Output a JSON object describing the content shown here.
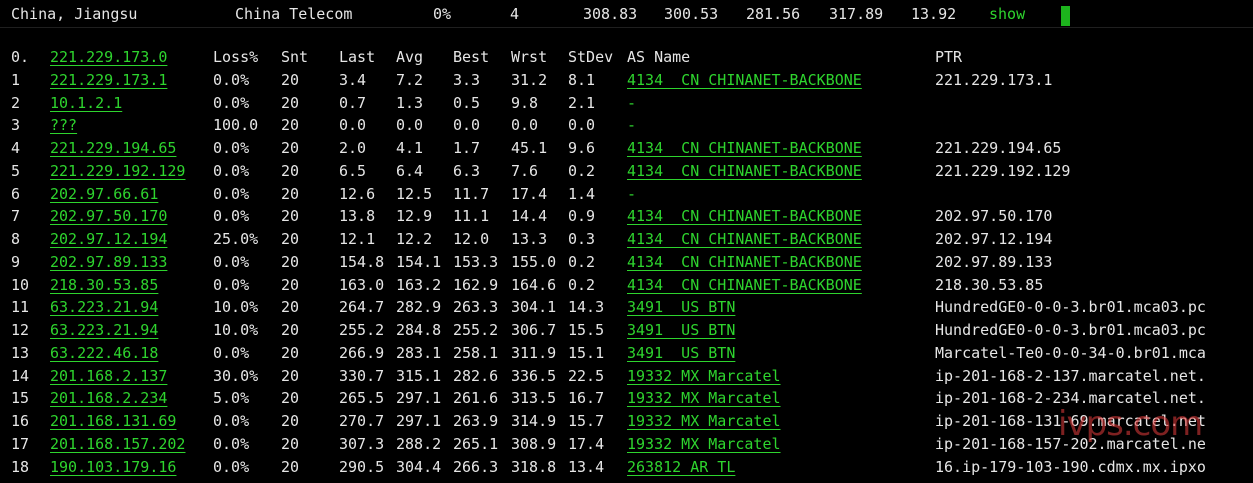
{
  "summary": {
    "location": "China, Jiangsu",
    "isp": "China Telecom",
    "loss": "0%",
    "sent": "4",
    "last": "308.83",
    "avg": "300.53",
    "best": "281.56",
    "worst": "317.89",
    "stdev": "13.92",
    "action": "show"
  },
  "table": {
    "headers": {
      "idx": "0.",
      "host": "221.229.173.0",
      "loss": "Loss%",
      "snt": "Snt",
      "last": "Last",
      "avg": "Avg",
      "best": "Best",
      "wrst": "Wrst",
      "stdev": "StDev",
      "as": "AS Name",
      "ptr": "PTR"
    },
    "rows": [
      {
        "idx": "1",
        "host": "221.229.173.1",
        "loss": "0.0%",
        "snt": "20",
        "last": "3.4",
        "avg": "7.2",
        "best": "3.3",
        "wrst": "31.2",
        "stdev": "8.1",
        "as": "4134  CN CHINANET-BACKBONE",
        "ptr": "221.229.173.1"
      },
      {
        "idx": "2",
        "host": "10.1.2.1",
        "loss": "0.0%",
        "snt": "20",
        "last": "0.7",
        "avg": "1.3",
        "best": "0.5",
        "wrst": "9.8",
        "stdev": "2.1",
        "as": "-",
        "ptr": ""
      },
      {
        "idx": "3",
        "host": "???",
        "loss": "100.0",
        "snt": "20",
        "last": "0.0",
        "avg": "0.0",
        "best": "0.0",
        "wrst": "0.0",
        "stdev": "0.0",
        "as": "-",
        "ptr": ""
      },
      {
        "idx": "4",
        "host": "221.229.194.65",
        "loss": "0.0%",
        "snt": "20",
        "last": "2.0",
        "avg": "4.1",
        "best": "1.7",
        "wrst": "45.1",
        "stdev": "9.6",
        "as": "4134  CN CHINANET-BACKBONE",
        "ptr": "221.229.194.65"
      },
      {
        "idx": "5",
        "host": "221.229.192.129",
        "loss": "0.0%",
        "snt": "20",
        "last": "6.5",
        "avg": "6.4",
        "best": "6.3",
        "wrst": "7.6",
        "stdev": "0.2",
        "as": "4134  CN CHINANET-BACKBONE",
        "ptr": "221.229.192.129"
      },
      {
        "idx": "6",
        "host": "202.97.66.61",
        "loss": "0.0%",
        "snt": "20",
        "last": "12.6",
        "avg": "12.5",
        "best": "11.7",
        "wrst": "17.4",
        "stdev": "1.4",
        "as": "-",
        "ptr": ""
      },
      {
        "idx": "7",
        "host": "202.97.50.170",
        "loss": "0.0%",
        "snt": "20",
        "last": "13.8",
        "avg": "12.9",
        "best": "11.1",
        "wrst": "14.4",
        "stdev": "0.9",
        "as": "4134  CN CHINANET-BACKBONE",
        "ptr": "202.97.50.170"
      },
      {
        "idx": "8",
        "host": "202.97.12.194",
        "loss": "25.0%",
        "snt": "20",
        "last": "12.1",
        "avg": "12.2",
        "best": "12.0",
        "wrst": "13.3",
        "stdev": "0.3",
        "as": "4134  CN CHINANET-BACKBONE",
        "ptr": "202.97.12.194"
      },
      {
        "idx": "9",
        "host": "202.97.89.133",
        "loss": "0.0%",
        "snt": "20",
        "last": "154.8",
        "avg": "154.1",
        "best": "153.3",
        "wrst": "155.0",
        "stdev": "0.2",
        "as": "4134  CN CHINANET-BACKBONE",
        "ptr": "202.97.89.133"
      },
      {
        "idx": "10",
        "host": "218.30.53.85",
        "loss": "0.0%",
        "snt": "20",
        "last": "163.0",
        "avg": "163.2",
        "best": "162.9",
        "wrst": "164.6",
        "stdev": "0.2",
        "as": "4134  CN CHINANET-BACKBONE",
        "ptr": "218.30.53.85"
      },
      {
        "idx": "11",
        "host": "63.223.21.94",
        "loss": "10.0%",
        "snt": "20",
        "last": "264.7",
        "avg": "282.9",
        "best": "263.3",
        "wrst": "304.1",
        "stdev": "14.3",
        "as": "3491  US BTN",
        "ptr": "HundredGE0-0-0-3.br01.mca03.pc"
      },
      {
        "idx": "12",
        "host": "63.223.21.94",
        "loss": "10.0%",
        "snt": "20",
        "last": "255.2",
        "avg": "284.8",
        "best": "255.2",
        "wrst": "306.7",
        "stdev": "15.5",
        "as": "3491  US BTN",
        "ptr": "HundredGE0-0-0-3.br01.mca03.pc"
      },
      {
        "idx": "13",
        "host": "63.222.46.18",
        "loss": "0.0%",
        "snt": "20",
        "last": "266.9",
        "avg": "283.1",
        "best": "258.1",
        "wrst": "311.9",
        "stdev": "15.1",
        "as": "3491  US BTN",
        "ptr": "Marcatel-Te0-0-0-34-0.br01.mca"
      },
      {
        "idx": "14",
        "host": "201.168.2.137",
        "loss": "30.0%",
        "snt": "20",
        "last": "330.7",
        "avg": "315.1",
        "best": "282.6",
        "wrst": "336.5",
        "stdev": "22.5",
        "as": "19332 MX Marcatel",
        "ptr": "ip-201-168-2-137.marcatel.net."
      },
      {
        "idx": "15",
        "host": "201.168.2.234",
        "loss": "5.0%",
        "snt": "20",
        "last": "265.5",
        "avg": "297.1",
        "best": "261.6",
        "wrst": "313.5",
        "stdev": "16.7",
        "as": "19332 MX Marcatel",
        "ptr": "ip-201-168-2-234.marcatel.net."
      },
      {
        "idx": "16",
        "host": "201.168.131.69",
        "loss": "0.0%",
        "snt": "20",
        "last": "270.7",
        "avg": "297.1",
        "best": "263.9",
        "wrst": "314.9",
        "stdev": "15.7",
        "as": "19332 MX Marcatel",
        "ptr": "ip-201-168-131-69.marcatel.net"
      },
      {
        "idx": "17",
        "host": "201.168.157.202",
        "loss": "0.0%",
        "snt": "20",
        "last": "307.3",
        "avg": "288.2",
        "best": "265.1",
        "wrst": "308.9",
        "stdev": "17.4",
        "as": "19332 MX Marcatel",
        "ptr": "ip-201-168-157-202.marcatel.ne"
      },
      {
        "idx": "18",
        "host": "190.103.179.16",
        "loss": "0.0%",
        "snt": "20",
        "last": "290.5",
        "avg": "304.4",
        "best": "266.3",
        "wrst": "318.8",
        "stdev": "13.4",
        "as": "263812 AR TL",
        "ptr": "16.ip-179-103-190.cdmx.mx.ipxo"
      }
    ]
  },
  "watermark": "ivps.com",
  "colors": {
    "background": "#000000",
    "text": "#e6e6e6",
    "accent_green": "#2ed42e"
  }
}
